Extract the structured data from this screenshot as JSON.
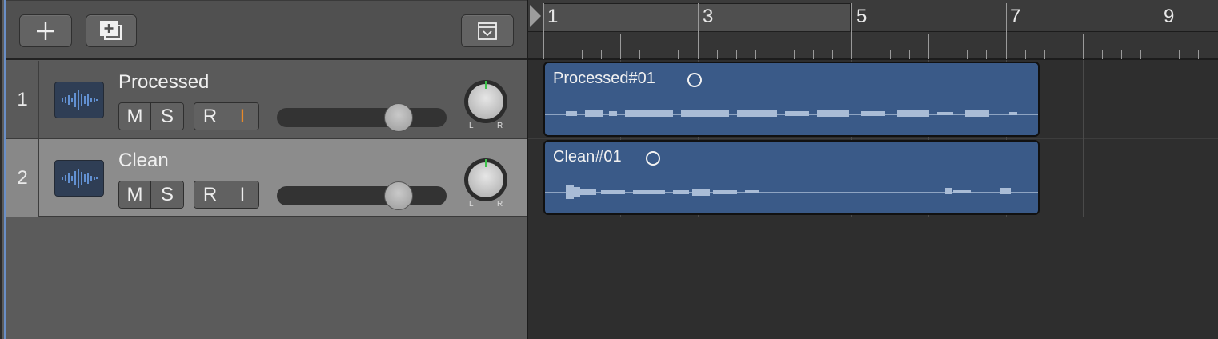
{
  "header": {
    "add_track_icon": "plus-icon",
    "add_region_icon": "add-duplicate-icon",
    "panel_icon": "dropdown-panel-icon"
  },
  "ruler": {
    "bars": [
      "1",
      "3",
      "5",
      "7",
      "9"
    ]
  },
  "tracks": [
    {
      "number": "1",
      "name": "Processed",
      "mute": "M",
      "solo": "S",
      "record": "R",
      "input": "I",
      "input_color": "#e88a2a",
      "pan_l": "L",
      "pan_r": "R",
      "region": {
        "name": "Processed#01"
      }
    },
    {
      "number": "2",
      "name": "Clean",
      "mute": "M",
      "solo": "S",
      "record": "R",
      "input": "I",
      "input_color": "#eeeeee",
      "pan_l": "L",
      "pan_r": "R",
      "region": {
        "name": "Clean#01"
      }
    }
  ],
  "colors": {
    "region": "#3a5a88",
    "pan_indicator": "#3cc24a",
    "waveform": "#a9bcd6"
  }
}
